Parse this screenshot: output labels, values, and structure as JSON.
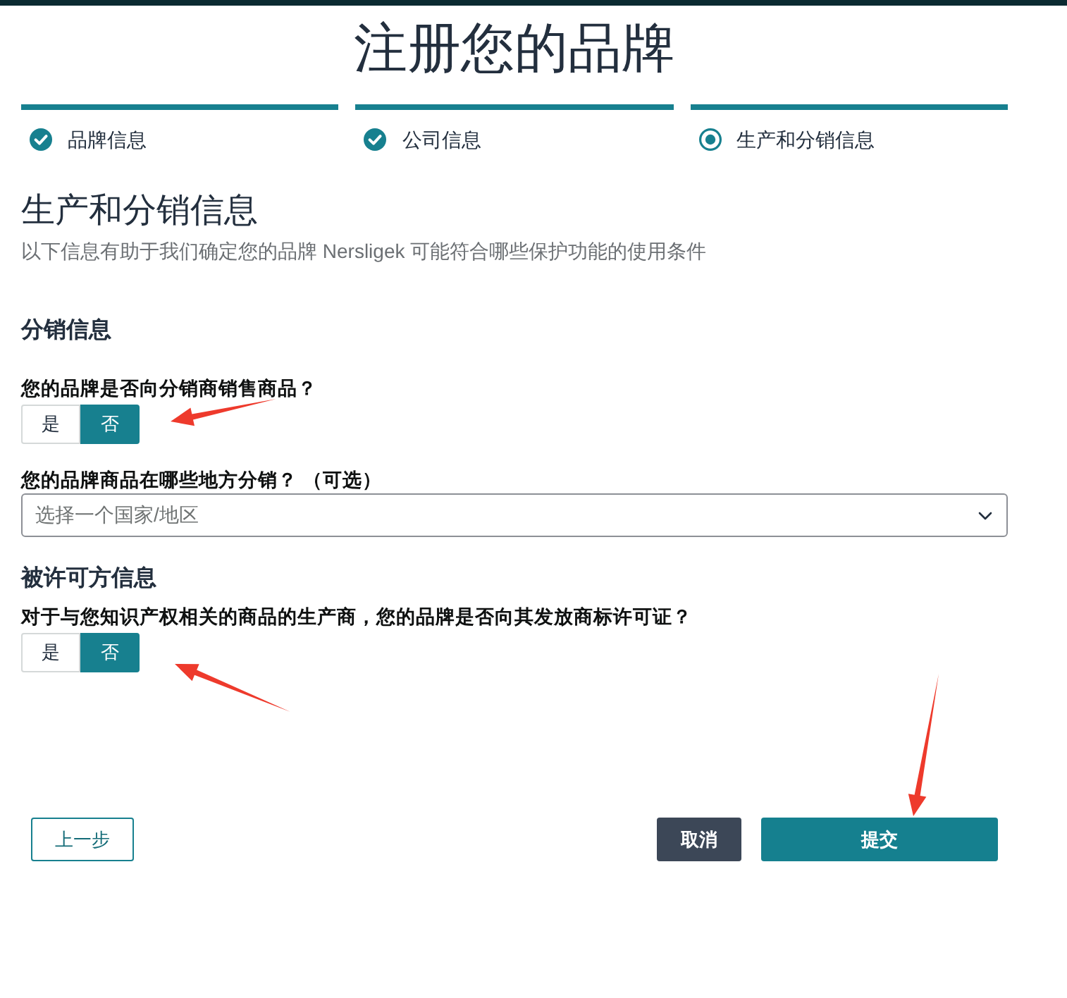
{
  "page_title": "注册您的品牌",
  "steps": [
    {
      "label": "品牌信息",
      "completed": true
    },
    {
      "label": "公司信息",
      "completed": true
    },
    {
      "label": "生产和分销信息",
      "completed": false
    }
  ],
  "section": {
    "title": "生产和分销信息",
    "subtitle": "以下信息有助于我们确定您的品牌 Nersligek 可能符合哪些保护功能的使用条件"
  },
  "groups": [
    {
      "heading": "分销信息",
      "fields": [
        {
          "kind": "toggle",
          "label": "您的品牌是否向分销商销售商品？",
          "options": [
            {
              "label": "是",
              "selected": false
            },
            {
              "label": "否",
              "selected": true
            }
          ]
        },
        {
          "kind": "select",
          "label": "您的品牌商品在哪些地方分销？ （可选）",
          "placeholder": "选择一个国家/地区"
        }
      ]
    },
    {
      "heading": "被许可方信息",
      "fields": [
        {
          "kind": "toggle",
          "label": "对于与您知识产权相关的商品的生产商，您的品牌是否向其发放商标许可证？",
          "options": [
            {
              "label": "是",
              "selected": false
            },
            {
              "label": "否",
              "selected": true
            }
          ]
        }
      ]
    }
  ],
  "buttons": [
    {
      "kind": "back",
      "label": "上一步"
    },
    {
      "kind": "cancel",
      "label": "取消"
    },
    {
      "kind": "submit",
      "label": "提交"
    }
  ]
}
